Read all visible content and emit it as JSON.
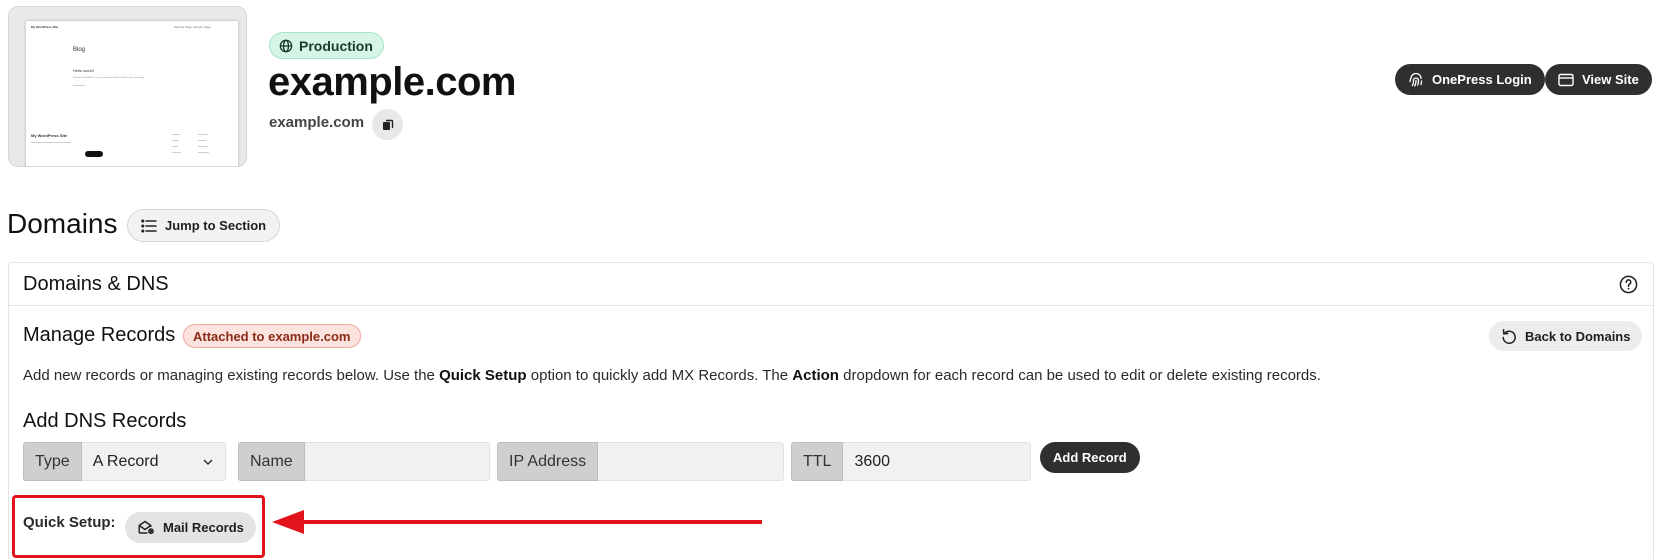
{
  "preview": {
    "site_name": "My WordPress Site",
    "nav": "Sample Page   Sample Page",
    "heading": "Blog",
    "post_title": "Hello world!",
    "post_excerpt": "Welcome to WordPress. This is your first post. Edit or delete it, then start writing!",
    "footer_site": "My WordPress Site"
  },
  "header": {
    "environment_badge": "Production",
    "site_title": "example.com",
    "site_domain": "example.com",
    "onepress_login": "OnePress Login",
    "view_site": "View Site"
  },
  "section": {
    "title": "Domains",
    "jump_button": "Jump to Section"
  },
  "card": {
    "title": "Domains & DNS",
    "manage_title": "Manage Records",
    "attached_badge": "Attached to example.com",
    "back_button": "Back to Domains",
    "desc_1": "Add new records or managing existing records below. Use the ",
    "desc_bold_1": "Quick Setup",
    "desc_2": " option to quickly add MX Records. The ",
    "desc_bold_2": "Action",
    "desc_3": " dropdown for each record can be used to edit or delete existing records.",
    "add_title": "Add DNS Records"
  },
  "form": {
    "type_label": "Type",
    "type_value": "A Record",
    "name_label": "Name",
    "name_value": "",
    "ip_label": "IP Address",
    "ip_value": "",
    "ttl_label": "TTL",
    "ttl_value": "3600",
    "add_button": "Add Record"
  },
  "quick_setup": {
    "label": "Quick Setup:",
    "mail_button": "Mail Records"
  },
  "colors": {
    "annotation_red": "#e3131c",
    "production_green": "#d6f5e6",
    "attached_pink": "#fde3dd",
    "dark_button": "#2f2f2f"
  }
}
